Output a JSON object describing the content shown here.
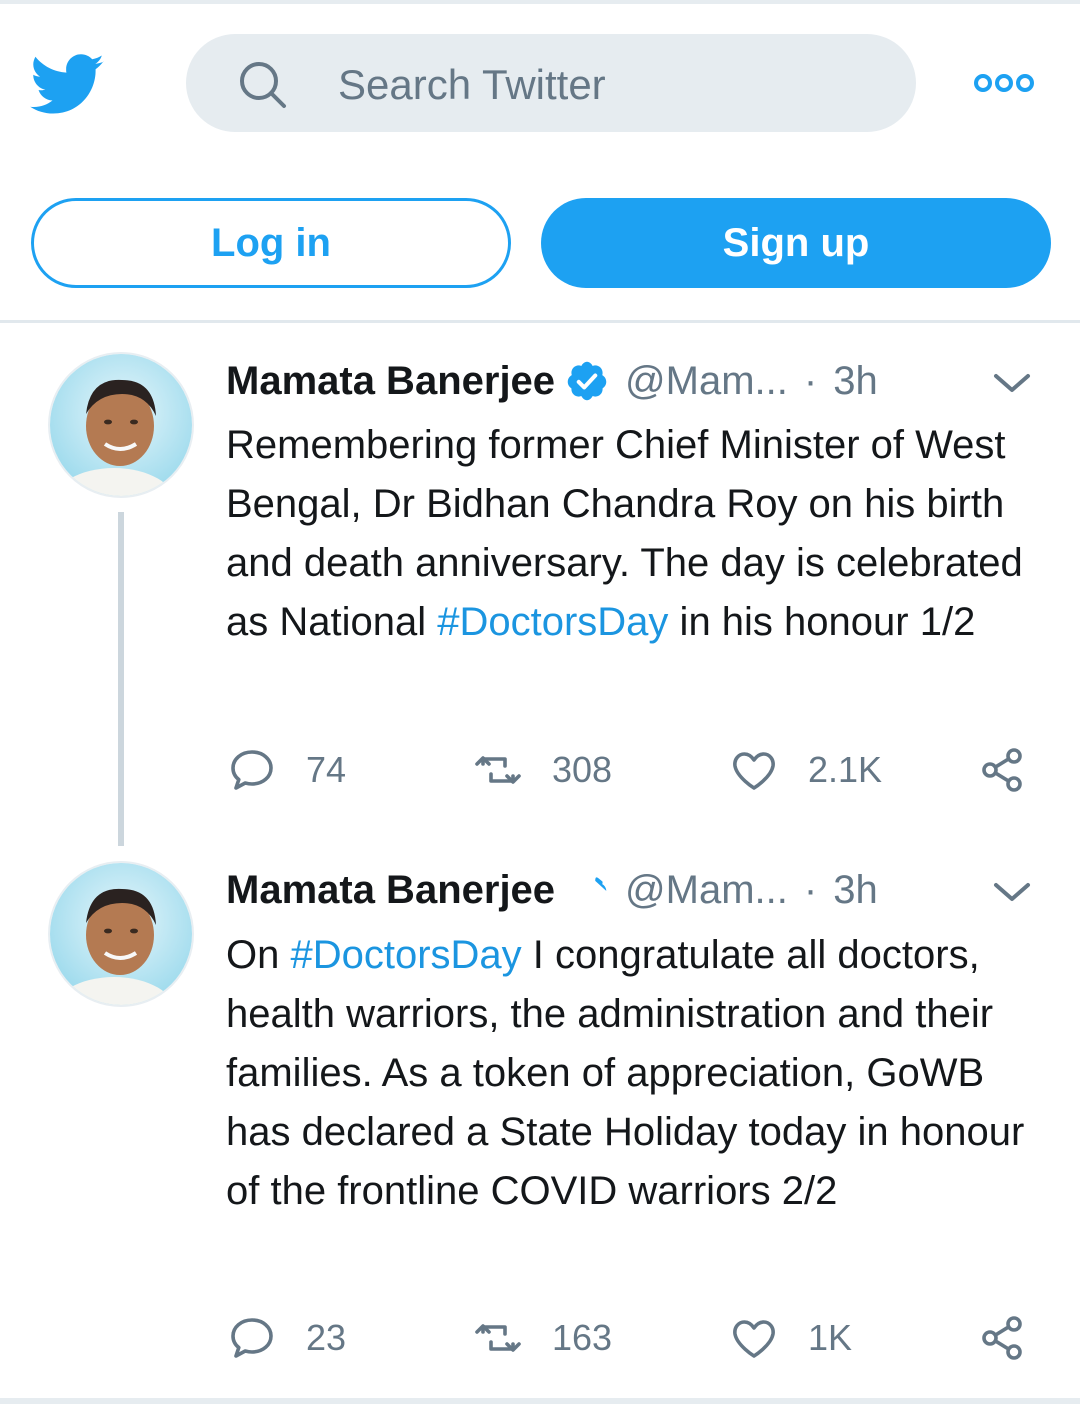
{
  "header": {
    "search_placeholder": "Search Twitter",
    "login_label": "Log in",
    "signup_label": "Sign up",
    "brand_color": "#1da1f2"
  },
  "tweets": [
    {
      "name": "Mamata Banerjee",
      "handle": "@Mam...",
      "separator": "·",
      "time": "3h",
      "text_parts": [
        "Remembering former Chief Minister of West Bengal, Dr Bidhan Chandra Roy on his birth and death anniversary. The day is celebrated as National ",
        "#DoctorsDay",
        " in his honour 1/2"
      ],
      "replies": "74",
      "retweets": "308",
      "likes": "2.1K"
    },
    {
      "name": "Mamata Banerjee",
      "handle": "@Mam...",
      "separator": "·",
      "time": "3h",
      "text_parts": [
        "On ",
        "#DoctorsDay",
        " I congratulate all doctors, health warriors, the administration and their families. As a token of appreciation, GoWB has declared a State Holiday today in honour of the frontline COVID warriors 2/2"
      ],
      "replies": "23",
      "retweets": "163",
      "likes": "1K"
    }
  ],
  "icons": {
    "logo": "twitter-bird-icon",
    "search": "search-icon",
    "more": "more-options-icon",
    "verified": "verified-badge-icon",
    "caret": "chevron-down-icon",
    "reply": "reply-icon",
    "retweet": "retweet-icon",
    "like": "heart-icon",
    "share": "share-icon"
  }
}
